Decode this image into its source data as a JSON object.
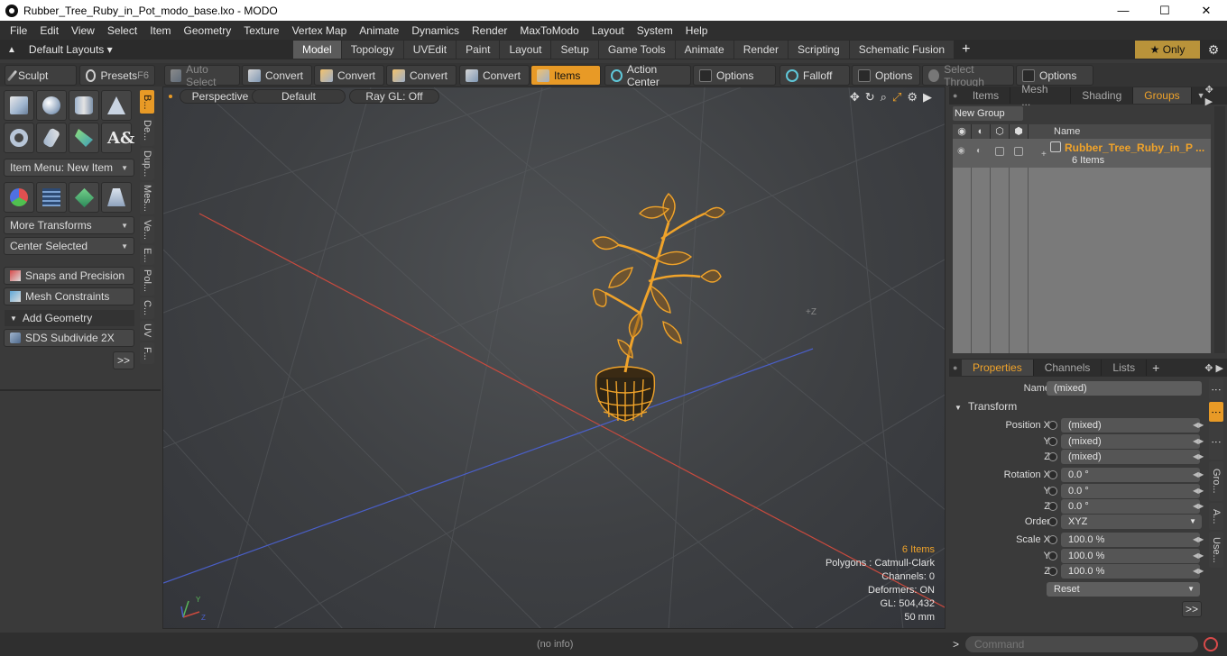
{
  "window": {
    "title": "Rubber_Tree_Ruby_in_Pot_modo_base.lxo - MODO",
    "minimize": "—",
    "maximize": "☐",
    "close": "✕"
  },
  "menu": [
    "File",
    "Edit",
    "View",
    "Select",
    "Item",
    "Geometry",
    "Texture",
    "Vertex Map",
    "Animate",
    "Dynamics",
    "Render",
    "MaxToModo",
    "Layout",
    "System",
    "Help"
  ],
  "layouts": {
    "label": "Default Layouts ▾"
  },
  "tabs": [
    "Model",
    "Topology",
    "UVEdit",
    "Paint",
    "Layout",
    "Setup",
    "Game Tools",
    "Animate",
    "Render",
    "Scripting",
    "Schematic Fusion"
  ],
  "tabs_active": "Model",
  "only_label": "★  Only",
  "toolbar": {
    "sculpt": "Sculpt",
    "presets": "Presets",
    "presets_key": "F6",
    "auto_select": "Auto Select",
    "convert1": "Convert",
    "convert2": "Convert",
    "convert3": "Convert",
    "convert4": "Convert",
    "items": "Items",
    "action_center": "Action Center",
    "options1": "Options",
    "falloff": "Falloff",
    "options2": "Options",
    "select_through": "Select Through",
    "options3": "Options"
  },
  "left": {
    "item_menu": "Item Menu: New Item",
    "more_transforms": "More Transforms",
    "center_selected": "Center Selected",
    "snaps": "Snaps and Precision",
    "mesh_constraints": "Mesh Constraints",
    "add_geometry": "Add Geometry",
    "sds": "SDS Subdivide 2X",
    "more": ">>",
    "vtabs": [
      "B...",
      "De...",
      "Dup...",
      "Mes...",
      "Ve...",
      "E...",
      "Pol...",
      "C...",
      "UV",
      "F..."
    ]
  },
  "viewport": {
    "view": "Perspective",
    "shading": "Default",
    "raygl": "Ray GL: Off",
    "z_label": "+Z",
    "stats": {
      "items": "6 Items",
      "polygons": "Polygons : Catmull-Clark",
      "channels": "Channels: 0",
      "deformers": "Deformers: ON",
      "gl": "GL: 504,432",
      "mm": "50 mm"
    },
    "colors": {
      "wire": "#f0a32a",
      "x_axis": "#c94a3e",
      "z_axis": "#4a5fc9"
    }
  },
  "groups_panel": {
    "tabs": [
      "Items",
      "Mesh ...",
      "Shading",
      "Groups"
    ],
    "active": "Groups",
    "new_group": "New Group",
    "col_name": "Name",
    "row_name": "Rubber_Tree_Ruby_in_P ...",
    "row_count": "6 Items"
  },
  "properties": {
    "tabs": [
      "Properties",
      "Channels",
      "Lists"
    ],
    "name_label": "Name",
    "name_value": "(mixed)",
    "transform": "Transform",
    "pos_x_label": "Position X",
    "pos_x": "(mixed)",
    "pos_y_label": "Y",
    "pos_y": "(mixed)",
    "pos_z_label": "Z",
    "pos_z": "(mixed)",
    "rot_x_label": "Rotation X",
    "rot_x": "0.0 °",
    "rot_y_label": "Y",
    "rot_y": "0.0 °",
    "rot_z_label": "Z",
    "rot_z": "0.0 °",
    "order_label": "Order",
    "order": "XYZ",
    "scale_x_label": "Scale X",
    "scale_x": "100.0 %",
    "scale_y_label": "Y",
    "scale_y": "100.0 %",
    "scale_z_label": "Z",
    "scale_z": "100.0 %",
    "reset": "Reset",
    "more": ">>",
    "vtabs": [
      "Gro...",
      "A...",
      "Use..."
    ]
  },
  "status": {
    "info": "(no info)",
    "command_placeholder": "Command",
    "prompt": ">"
  }
}
